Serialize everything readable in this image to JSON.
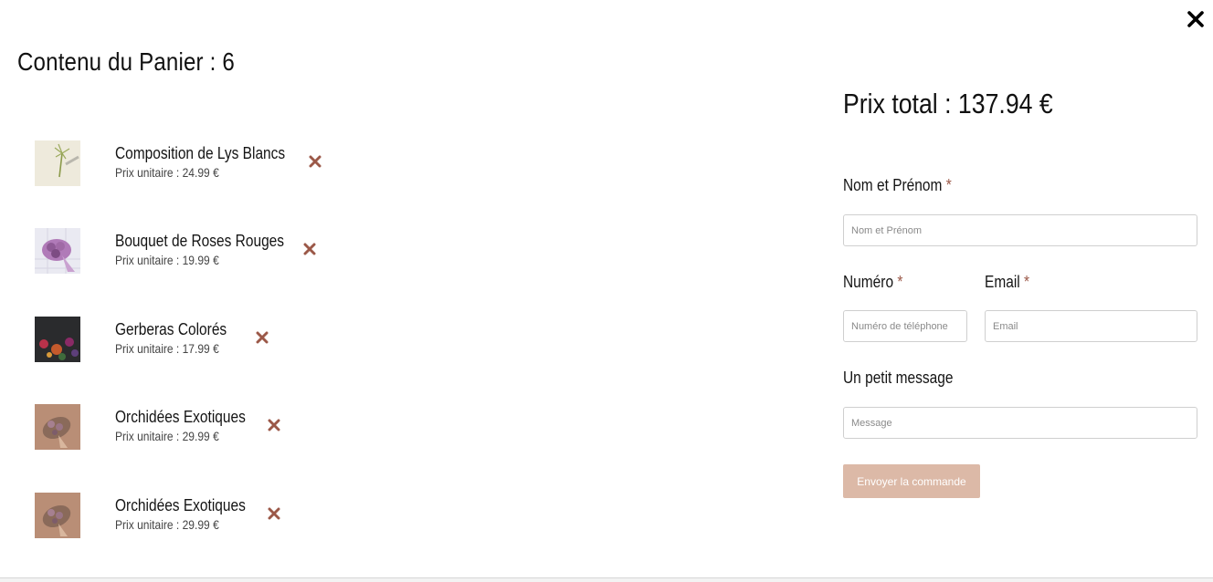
{
  "cart": {
    "title": "Contenu du Panier : 6",
    "items": [
      {
        "name": "Composition de Lys Blancs",
        "price": "Prix unitaire : 24.99 €"
      },
      {
        "name": "Bouquet de Roses Rouges",
        "price": "Prix unitaire : 19.99 €"
      },
      {
        "name": "Gerberas Colorés",
        "price": "Prix unitaire : 17.99 €"
      },
      {
        "name": "Orchidées Exotiques",
        "price": "Prix unitaire : 29.99 €"
      },
      {
        "name": "Orchidées Exotiques",
        "price": "Prix unitaire : 29.99 €"
      }
    ]
  },
  "order": {
    "total": "Prix total : 137.94 €",
    "name_label": "Nom et Prénom",
    "name_placeholder": "Nom et Prénom",
    "phone_label": "Numéro",
    "phone_placeholder": "Numéro de téléphone",
    "email_label": "Email",
    "email_placeholder": "Email",
    "message_label": "Un petit message",
    "message_placeholder": "Message",
    "required_mark": "*",
    "submit_label": "Envoyer la commande"
  },
  "colors": {
    "accent": "#9b5848",
    "button": "#dcb9a7"
  },
  "icons": {
    "close": "close-icon",
    "remove": "remove-icon"
  }
}
